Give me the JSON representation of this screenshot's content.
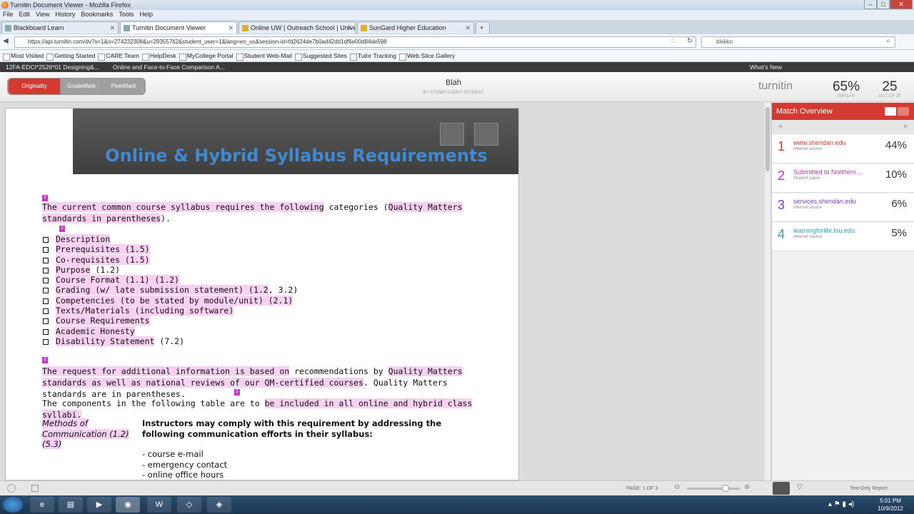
{
  "window": {
    "title": "Turnitin Document Viewer - Mozilla Firefox"
  },
  "menu": [
    "File",
    "Edit",
    "View",
    "History",
    "Bookmarks",
    "Tools",
    "Help"
  ],
  "tabs": [
    "Blackboard Learn",
    "Turnitin Document Viewer",
    "Online UW | Outreach School | Univer...",
    "SunGard Higher Education"
  ],
  "address": {
    "url": "https://api.turnitin.com/dv?s=1&o=274232308&u=29355762&student_user=1&lang=en_us&session-id=fd2624de7b0ad42dd1df6e00d84de598",
    "search": "blekko"
  },
  "bookmarks": [
    "Most Visited",
    "Getting Started",
    "CARE Team",
    "HelpDesk",
    "MyCollege Portal",
    "Student Web-Mail",
    "Suggested Sites",
    "Tutor Tracking",
    "Web Slice Gallery"
  ],
  "tii_bar": {
    "class": "12FA-EDCI*2526*01 Designing&...",
    "assignment": "Online and Face-to-Face Comparison A...",
    "whats_new": "What's New"
  },
  "modes": [
    "Originality",
    "GradeMark",
    "PeerMark"
  ],
  "paper": {
    "title": "Blah",
    "author": "BY STONEYCADDY STUDENT"
  },
  "score": {
    "brand": "turnitin",
    "similar": "65%",
    "similar_label": "SIMILAR",
    "outof": "25",
    "outof_label": "OUT OF 25"
  },
  "doc": {
    "heading": "Online & Hybrid Syllabus Requirements",
    "intro_a": "The current common course syllabus requires the following",
    "intro_b": " categories (",
    "intro_c": "Quality Matters standards in parentheses",
    "intro_d": ").",
    "items": [
      {
        "hl": "Description",
        "rest": ""
      },
      {
        "hl": "Prerequisites (1.5)",
        "rest": ""
      },
      {
        "hl": "Co-requisites (1.5)",
        "rest": ""
      },
      {
        "hl": "Purpose",
        "rest": " (1.2)"
      },
      {
        "hl": "Course Format (1.1) (1.2)",
        "rest": ""
      },
      {
        "hl": "Grading (w/ late submission statement) (1.2",
        "rest": ", 3.2)"
      },
      {
        "hl": "Competencies (to be stated by module/unit) (2.1)",
        "rest": ""
      },
      {
        "hl": "Texts/Materials (including software)",
        "rest": ""
      },
      {
        "hl": "Course Requirements",
        "rest": ""
      },
      {
        "hl": "Academic Honesty",
        "rest": ""
      },
      {
        "hl": "Disability Statement",
        "rest": " (7.2)"
      }
    ],
    "para2_a": "The request for additional information is based on",
    "para2_b": " recommendations by ",
    "para2_c": "Quality Matters standards as well as national reviews of our QM-certified courses",
    "para2_d": ". Quality Matters standards are in parentheses.",
    "para3_a": "The components in the following table are to ",
    "para3_b": "be included in all online and hybrid class syllabi.",
    "methods": "Methods of Communication (1.2) (5.3)",
    "instructors": "Instructors may comply with this requirement by addressing the following communication efforts in their syllabus:",
    "comms": [
      "- course e-mail",
      "- emergency contact",
      "- online office hours"
    ],
    "mark": "2"
  },
  "match": {
    "header": "Match Overview",
    "items": [
      {
        "num": "1",
        "source": "www.sheridan.edu",
        "type": "Internet source",
        "pct": "44%",
        "color": "#d33a32"
      },
      {
        "num": "2",
        "source": "Submitted to Northern ...",
        "type": "Student paper",
        "pct": "10%",
        "color": "#b833c0"
      },
      {
        "num": "3",
        "source": "services.sheridan.edu",
        "type": "Internet source",
        "pct": "6%",
        "color": "#7b3fc4"
      },
      {
        "num": "4",
        "source": "learningforlife.fsu.edu",
        "type": "Internet source",
        "pct": "5%",
        "color": "#2a9fb8"
      }
    ]
  },
  "bottom": {
    "page": "PAGE: 1 OF 3",
    "textonly": "Text-Only Report"
  },
  "clock": {
    "time": "5:01 PM",
    "date": "10/9/2012"
  }
}
